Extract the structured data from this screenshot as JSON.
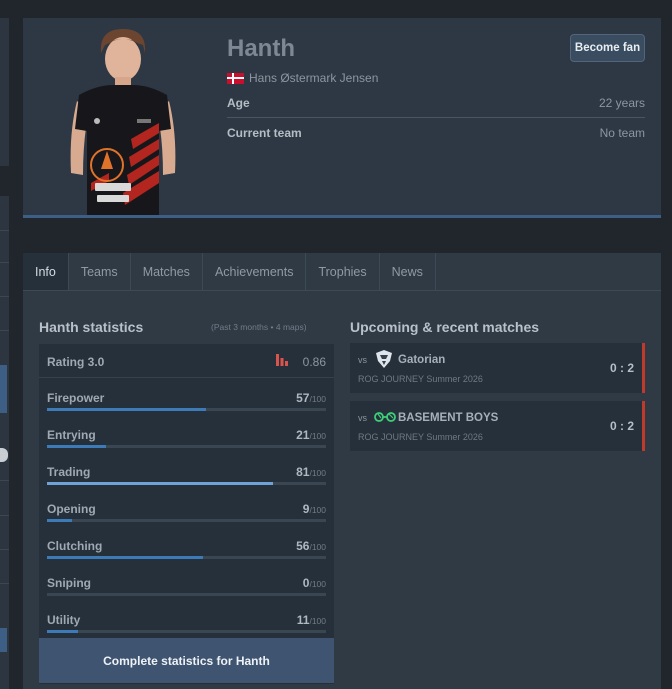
{
  "player": {
    "nickname": "Hanth",
    "real_name": "Hans Østermark Jensen",
    "flag_icon": "denmark-flag-icon",
    "fan_button": "Become fan",
    "age_label": "Age",
    "age_value": "22 years",
    "team_label": "Current team",
    "team_value": "No team"
  },
  "tabs": [
    "Info",
    "Teams",
    "Matches",
    "Achievements",
    "Trophies",
    "News"
  ],
  "active_tab": "Info",
  "stats": {
    "title": "Hanth statistics",
    "subtitle": "(Past 3 months • 4 maps)",
    "rating_label": "Rating 3.0",
    "rating_icon": "bar-chart-icon",
    "rating_value": "0.86",
    "max_label": "/100",
    "rows": [
      {
        "label": "Firepower",
        "value": "57",
        "percent": 57
      },
      {
        "label": "Entrying",
        "value": "21",
        "percent": 21
      },
      {
        "label": "Trading",
        "value": "81",
        "percent": 81
      },
      {
        "label": "Opening",
        "value": "9",
        "percent": 9
      },
      {
        "label": "Clutching",
        "value": "56",
        "percent": 56
      },
      {
        "label": "Sniping",
        "value": "0",
        "percent": 0
      },
      {
        "label": "Utility",
        "value": "11",
        "percent": 11
      }
    ],
    "complete_button": "Complete statistics for Hanth"
  },
  "matches": {
    "title": "Upcoming & recent matches",
    "items": [
      {
        "vs": "vs",
        "team": "Gatorian",
        "logo": "gatorian-logo-icon",
        "event": "ROG JOURNEY Summer 2026",
        "score": "0 : 2",
        "result_color": "#c0392b"
      },
      {
        "vs": "vs",
        "team": "BASEMENT BOYS",
        "logo": "basement-boys-logo-icon",
        "event": "ROG JOURNEY Summer 2026",
        "score": "0 : 2",
        "result_color": "#c0392b"
      }
    ]
  },
  "colors": {
    "accent": "#3d7ab8",
    "loss": "#c0392b",
    "button": "#3f5470"
  }
}
